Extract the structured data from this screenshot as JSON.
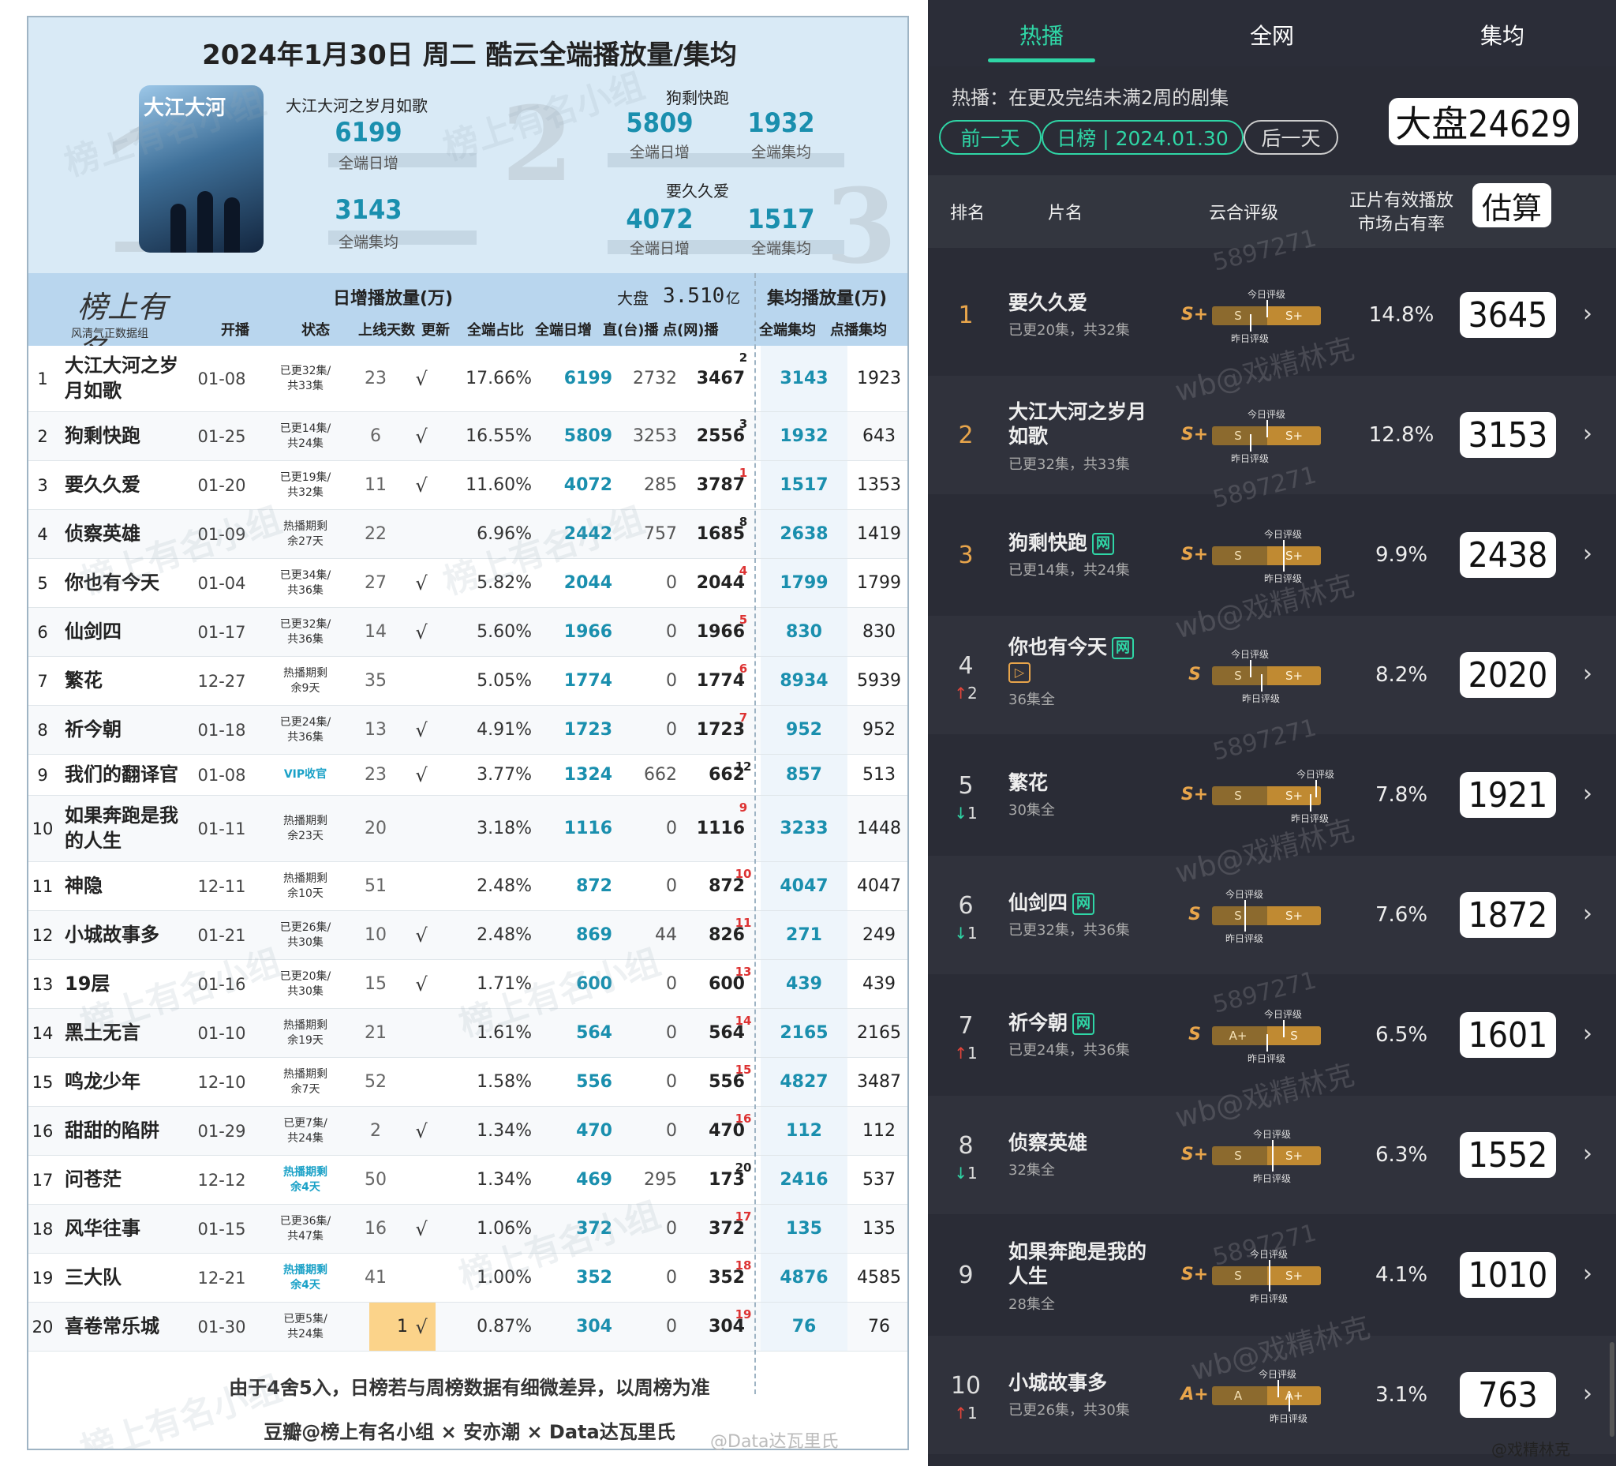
{
  "left": {
    "title": "2024年1月30日 周二 酷云全端播放量/集均",
    "poster_text": "大江大河",
    "top": [
      {
        "rank_mark": "1",
        "name": "大江大河之岁月如歌",
        "daily": "6199",
        "daily_label": "全端日增",
        "avg": "3143",
        "avg_label": "全端集均"
      },
      {
        "rank_mark": "2",
        "name": "狗剩快跑",
        "daily": "5809",
        "daily_label": "全端日增",
        "avg": "1932",
        "avg_label": "全端集均"
      },
      {
        "rank_mark": "3",
        "name": "要久久爱",
        "daily": "4072",
        "daily_label": "全端日增",
        "avg": "1517",
        "avg_label": "全端集均"
      }
    ],
    "logo_text": "榜上有名",
    "logo_sub": "风清气正数据组",
    "group_daily": "日增播放量(万)",
    "dapan_label": "大盘",
    "dapan_value": "3.510",
    "dapan_unit": "亿",
    "group_avg": "集均播放量(万)",
    "columns": [
      "开播",
      "状态",
      "上线天数",
      "更新",
      "全端占比",
      "全端日增",
      "直(台)播",
      "点(网)播",
      "全端集均",
      "点播集均"
    ],
    "rows": [
      {
        "rank": "1",
        "name": "大江大河之岁月如歌",
        "date": "01-08",
        "status": "已更32集/共33集",
        "days": "23",
        "upd": "√",
        "share": "17.66%",
        "total": "6199",
        "tv": "2732",
        "web": "3467",
        "wrank": "2",
        "avg": "3143",
        "pavg": "1923"
      },
      {
        "rank": "2",
        "name": "狗剩快跑",
        "date": "01-25",
        "status": "已更14集/共24集",
        "days": "6",
        "upd": "√",
        "share": "16.55%",
        "total": "5809",
        "tv": "3253",
        "web": "2556",
        "wrank": "3",
        "avg": "1932",
        "pavg": "643"
      },
      {
        "rank": "3",
        "name": "要久久爱",
        "date": "01-20",
        "status": "已更19集/共32集",
        "days": "11",
        "upd": "√",
        "share": "11.60%",
        "total": "4072",
        "tv": "285",
        "web": "3787",
        "wrank": "1",
        "avg": "1517",
        "pavg": "1353"
      },
      {
        "rank": "4",
        "name": "侦察英雄",
        "date": "01-09",
        "status": "热播期剩余27天",
        "days": "22",
        "upd": "",
        "share": "6.96%",
        "total": "2442",
        "tv": "757",
        "web": "1685",
        "wrank": "8",
        "avg": "2638",
        "pavg": "1419"
      },
      {
        "rank": "5",
        "name": "你也有今天",
        "date": "01-04",
        "status": "已更34集/共36集",
        "days": "27",
        "upd": "√",
        "share": "5.82%",
        "total": "2044",
        "tv": "0",
        "web": "2044",
        "wrank": "4",
        "avg": "1799",
        "pavg": "1799"
      },
      {
        "rank": "6",
        "name": "仙剑四",
        "date": "01-17",
        "status": "已更32集/共36集",
        "days": "14",
        "upd": "√",
        "share": "5.60%",
        "total": "1966",
        "tv": "0",
        "web": "1966",
        "wrank": "5",
        "avg": "830",
        "pavg": "830"
      },
      {
        "rank": "7",
        "name": "繁花",
        "date": "12-27",
        "status": "热播期剩余9天",
        "days": "35",
        "upd": "",
        "share": "5.05%",
        "total": "1774",
        "tv": "0",
        "web": "1774",
        "wrank": "6",
        "avg": "8934",
        "pavg": "5939"
      },
      {
        "rank": "8",
        "name": "祈今朝",
        "date": "01-18",
        "status": "已更24集/共36集",
        "days": "13",
        "upd": "√",
        "share": "4.91%",
        "total": "1723",
        "tv": "0",
        "web": "1723",
        "wrank": "7",
        "avg": "952",
        "pavg": "952"
      },
      {
        "rank": "9",
        "name": "我们的翻译官",
        "date": "01-08",
        "status": "VIP收官",
        "days": "23",
        "upd": "√",
        "share": "3.77%",
        "total": "1324",
        "tv": "662",
        "web": "662",
        "wrank": "12",
        "avg": "857",
        "pavg": "513"
      },
      {
        "rank": "10",
        "name": "如果奔跑是我的人生",
        "date": "01-11",
        "status": "热播期剩余23天",
        "days": "20",
        "upd": "",
        "share": "3.18%",
        "total": "1116",
        "tv": "0",
        "web": "1116",
        "wrank": "9",
        "avg": "3233",
        "pavg": "1448"
      },
      {
        "rank": "11",
        "name": "神隐",
        "date": "12-11",
        "status": "热播期剩余10天",
        "days": "51",
        "upd": "",
        "share": "2.48%",
        "total": "872",
        "tv": "0",
        "web": "872",
        "wrank": "10",
        "avg": "4047",
        "pavg": "4047"
      },
      {
        "rank": "12",
        "name": "小城故事多",
        "date": "01-21",
        "status": "已更26集/共30集",
        "days": "10",
        "upd": "√",
        "share": "2.48%",
        "total": "869",
        "tv": "44",
        "web": "826",
        "wrank": "11",
        "avg": "271",
        "pavg": "249"
      },
      {
        "rank": "13",
        "name": "19层",
        "date": "01-16",
        "status": "已更20集/共30集",
        "days": "15",
        "upd": "√",
        "share": "1.71%",
        "total": "600",
        "tv": "0",
        "web": "600",
        "wrank": "13",
        "avg": "439",
        "pavg": "439"
      },
      {
        "rank": "14",
        "name": "黑土无言",
        "date": "01-10",
        "status": "热播期剩余19天",
        "days": "21",
        "upd": "",
        "share": "1.61%",
        "total": "564",
        "tv": "0",
        "web": "564",
        "wrank": "14",
        "avg": "2165",
        "pavg": "2165"
      },
      {
        "rank": "15",
        "name": "鸣龙少年",
        "date": "12-10",
        "status": "热播期剩余7天",
        "days": "52",
        "upd": "",
        "share": "1.58%",
        "total": "556",
        "tv": "0",
        "web": "556",
        "wrank": "15",
        "avg": "4827",
        "pavg": "3487"
      },
      {
        "rank": "16",
        "name": "甜甜的陷阱",
        "date": "01-29",
        "status": "已更7集/共24集",
        "days": "2",
        "upd": "√",
        "share": "1.34%",
        "total": "470",
        "tv": "0",
        "web": "470",
        "wrank": "16",
        "avg": "112",
        "pavg": "112"
      },
      {
        "rank": "17",
        "name": "问苍茫",
        "date": "12-12",
        "status": "热播期剩余4天",
        "days": "50",
        "upd": "",
        "share": "1.34%",
        "total": "469",
        "tv": "295",
        "web": "173",
        "wrank": "20",
        "avg": "2416",
        "pavg": "537"
      },
      {
        "rank": "18",
        "name": "风华往事",
        "date": "01-15",
        "status": "已更36集/共47集",
        "days": "16",
        "upd": "√",
        "share": "1.06%",
        "total": "372",
        "tv": "0",
        "web": "372",
        "wrank": "17",
        "avg": "135",
        "pavg": "135"
      },
      {
        "rank": "19",
        "name": "三大队",
        "date": "12-21",
        "status": "热播期剩余4天",
        "days": "41",
        "upd": "",
        "share": "1.00%",
        "total": "352",
        "tv": "0",
        "web": "352",
        "wrank": "18",
        "avg": "4876",
        "pavg": "4585"
      },
      {
        "rank": "20",
        "name": "喜卷常乐城",
        "date": "01-30",
        "status": "已更5集/共24集",
        "days": "1",
        "upd": "√",
        "share": "0.87%",
        "total": "304",
        "tv": "0",
        "web": "304",
        "wrank": "19",
        "avg": "76",
        "pavg": "76"
      }
    ],
    "footer_note": "由于4舍5入，日榜若与周榜数据有细微差异，以周榜为准",
    "footer_credit": "豆瓣@榜上有名小组 × 安亦潮 × Data达瓦里氏",
    "corner_credit": "@Data达瓦里氏",
    "watermark": "榜上有名小组"
  },
  "right": {
    "tabs": [
      "热播",
      "全网",
      "集均"
    ],
    "info": "热播：在更及完结未满2周的剧集",
    "prev_day": "前一天",
    "date_pill": "日榜 | 2024.01.30",
    "next_day": "后一天",
    "dapan": "大盘24629",
    "headers": {
      "rank": "排名",
      "title": "片名",
      "grade": "云合评级",
      "share_l1": "正片有效播放",
      "share_l2": "市场占有率",
      "estimate": "估算"
    },
    "today_label": "今日评级",
    "yesterday_label": "昨日评级",
    "rows": [
      {
        "rank": "1",
        "change": "",
        "dir": "",
        "title": "要久久爱",
        "badge": "",
        "play": false,
        "sub": "已更20集，共32集",
        "grade": "S+",
        "left_grade": "S",
        "right_grade": "S+",
        "pct": "14.8%",
        "value": "3645"
      },
      {
        "rank": "2",
        "change": "",
        "dir": "",
        "title": "大江大河之岁月如歌",
        "badge": "",
        "play": false,
        "sub": "已更32集，共33集",
        "grade": "S+",
        "left_grade": "S",
        "right_grade": "S+",
        "pct": "12.8%",
        "value": "3153"
      },
      {
        "rank": "3",
        "change": "",
        "dir": "",
        "title": "狗剩快跑",
        "badge": "网",
        "play": false,
        "sub": "已更14集，共24集",
        "grade": "S+",
        "left_grade": "S",
        "right_grade": "S+",
        "pct": "9.9%",
        "value": "2438"
      },
      {
        "rank": "4",
        "change": "2",
        "dir": "up",
        "title": "你也有今天",
        "badge": "网",
        "play": true,
        "sub": "36集全",
        "grade": "S",
        "left_grade": "S",
        "right_grade": "S+",
        "pct": "8.2%",
        "value": "2020"
      },
      {
        "rank": "5",
        "change": "1",
        "dir": "down",
        "title": "繁花",
        "badge": "",
        "play": false,
        "sub": "30集全",
        "grade": "S+",
        "left_grade": "S",
        "right_grade": "S+",
        "pct": "7.8%",
        "value": "1921"
      },
      {
        "rank": "6",
        "change": "1",
        "dir": "down",
        "title": "仙剑四",
        "badge": "网",
        "play": false,
        "sub": "已更32集，共36集",
        "grade": "S",
        "left_grade": "S",
        "right_grade": "S+",
        "pct": "7.6%",
        "value": "1872"
      },
      {
        "rank": "7",
        "change": "1",
        "dir": "up",
        "title": "祈今朝",
        "badge": "网",
        "play": false,
        "sub": "已更24集，共36集",
        "grade": "S",
        "left_grade": "A+",
        "right_grade": "S",
        "pct": "6.5%",
        "value": "1601"
      },
      {
        "rank": "8",
        "change": "1",
        "dir": "down",
        "title": "侦察英雄",
        "badge": "",
        "play": false,
        "sub": "32集全",
        "grade": "S+",
        "left_grade": "S",
        "right_grade": "S+",
        "pct": "6.3%",
        "value": "1552"
      },
      {
        "rank": "9",
        "change": "",
        "dir": "",
        "title": "如果奔跑是我的人生",
        "badge": "",
        "play": false,
        "sub": "28集全",
        "grade": "S+",
        "left_grade": "S",
        "right_grade": "S+",
        "pct": "4.1%",
        "value": "1010"
      },
      {
        "rank": "10",
        "change": "1",
        "dir": "up",
        "title": "小城故事多",
        "badge": "",
        "play": false,
        "sub": "已更26集，共30集",
        "grade": "A+",
        "left_grade": "A",
        "right_grade": "A+",
        "pct": "3.1%",
        "value": "763"
      }
    ],
    "watermark": "wb@戏精林克",
    "watermark_num": "5897271",
    "credit": "@戏精林克"
  }
}
